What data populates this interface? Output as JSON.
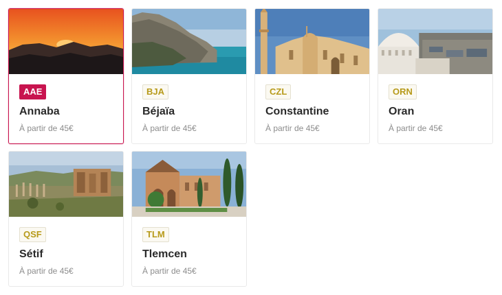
{
  "destinations": [
    {
      "code": "AAE",
      "city": "Annaba",
      "price": "À partir de 45€",
      "selected": true,
      "image": "sunset-mountains"
    },
    {
      "code": "BJA",
      "city": "Béjaïa",
      "price": "À partir de 45€",
      "selected": false,
      "image": "coastal-cliff"
    },
    {
      "code": "CZL",
      "city": "Constantine",
      "price": "À partir de 45€",
      "selected": false,
      "image": "mosque"
    },
    {
      "code": "ORN",
      "city": "Oran",
      "price": "À partir de 45€",
      "selected": false,
      "image": "domed-building-city"
    },
    {
      "code": "QSF",
      "city": "Sétif",
      "price": "À partir de 45€",
      "selected": false,
      "image": "roman-ruins"
    },
    {
      "code": "TLM",
      "city": "Tlemcen",
      "price": "À partir de 45€",
      "selected": false,
      "image": "palace-garden"
    }
  ],
  "colors": {
    "accent": "#c8144f",
    "code_text": "#b79a1a"
  }
}
